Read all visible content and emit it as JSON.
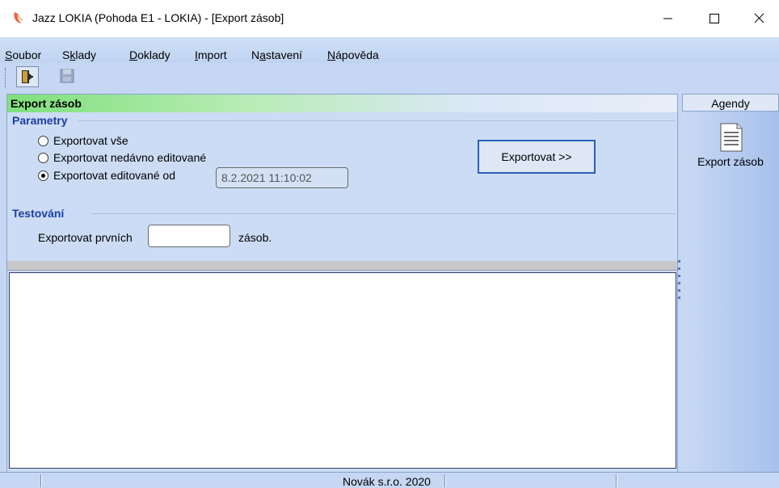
{
  "window": {
    "title": "Jazz LOKIA (Pohoda E1 - LOKIA) - [Export zásob]",
    "buttons": {
      "minimize": "minimize",
      "maximize": "maximize",
      "close": "close"
    }
  },
  "menu": [
    {
      "label": "Soubor"
    },
    {
      "label": "Sklady"
    },
    {
      "label": "Doklady"
    },
    {
      "label": "Import"
    },
    {
      "label": "Nastavení"
    },
    {
      "label": "Nápověda"
    }
  ],
  "toolbar": {
    "exit_icon": "exit-door-icon",
    "save_icon": "save-disk-icon"
  },
  "section": {
    "title": "Export zásob"
  },
  "parametry": {
    "label": "Parametry",
    "options": [
      {
        "label": "Exportovat vše",
        "checked": false
      },
      {
        "label": "Exportovat nedávno editované",
        "checked": false
      },
      {
        "label": "Exportovat editované od",
        "checked": true
      }
    ],
    "date_value": "8.2.2021 11:10:02",
    "export_button": "Exportovat >>"
  },
  "testovani": {
    "label": "Testování",
    "prefix": "Exportovat prvních",
    "value": "",
    "suffix": "zásob."
  },
  "agendy": {
    "header": "Agendy",
    "item_label": "Export zásob",
    "item_icon": "document-icon"
  },
  "status": {
    "text": "Novák s.r.o. 2020"
  },
  "colors": {
    "accent_blue": "#1c3da5",
    "header_green": "#7ee07b",
    "button_border": "#2a5fb8"
  }
}
